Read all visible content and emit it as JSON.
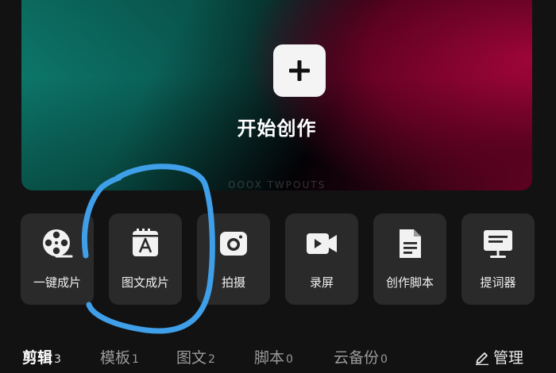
{
  "hero": {
    "action_label": "开始创作",
    "watermark": "OOOX TWPOUTS",
    "plus_icon": "plus-icon"
  },
  "tools": [
    {
      "label": "一键成片",
      "icon": "film-reel-icon"
    },
    {
      "label": "图文成片",
      "icon": "text-image-icon"
    },
    {
      "label": "拍摄",
      "icon": "camera-icon"
    },
    {
      "label": "录屏",
      "icon": "screen-record-icon"
    },
    {
      "label": "创作脚本",
      "icon": "script-document-icon"
    },
    {
      "label": "提词器",
      "icon": "teleprompter-icon"
    }
  ],
  "tabs": [
    {
      "label": "剪辑",
      "count": "3",
      "active": true
    },
    {
      "label": "模板",
      "count": "1",
      "active": false
    },
    {
      "label": "图文",
      "count": "2",
      "active": false
    },
    {
      "label": "脚本",
      "count": "0",
      "active": false
    },
    {
      "label": "云备份",
      "count": "0",
      "active": false
    }
  ],
  "manage": {
    "label": "管理",
    "icon": "pencil-edit-icon"
  },
  "colors": {
    "background": "#121212",
    "tile": "#2a2a2a",
    "annotation": "#3f9fe8",
    "hero_teal": "#0d7c6e",
    "hero_crimson": "#a3053a"
  }
}
